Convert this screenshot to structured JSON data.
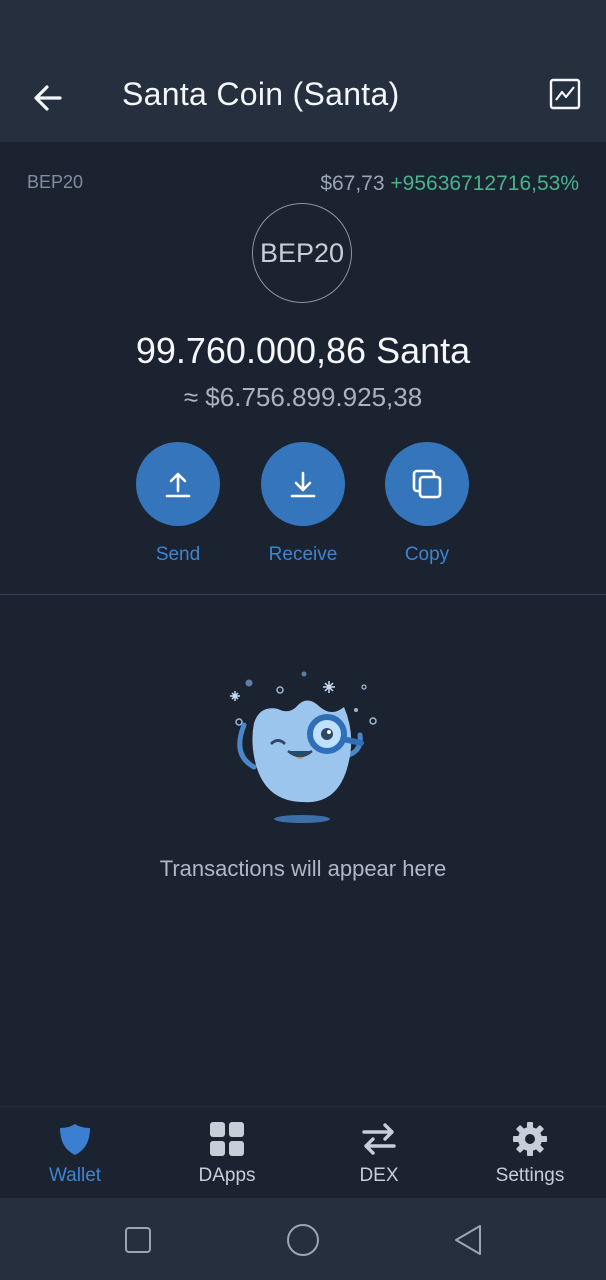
{
  "status_bar": {
    "time": "",
    "indicators": ""
  },
  "header": {
    "title": "Santa Coin (Santa)"
  },
  "token": {
    "network": "BEP20",
    "logo_text": "BEP20",
    "price": "$67,73",
    "change": "+95636712716,53%",
    "balance": "99.760.000,86 Santa",
    "fiat_value": "≈ $6.756.899.925,38"
  },
  "actions": [
    {
      "label": "Send",
      "icon": "upload-icon"
    },
    {
      "label": "Receive",
      "icon": "download-icon"
    },
    {
      "label": "Copy",
      "icon": "copy-icon"
    }
  ],
  "empty_state": {
    "message": "Transactions will appear here"
  },
  "bottom_nav": [
    {
      "label": "Wallet",
      "icon": "shield-icon",
      "active": true
    },
    {
      "label": "DApps",
      "icon": "grid-icon",
      "active": false
    },
    {
      "label": "DEX",
      "icon": "swap-arrows-icon",
      "active": false
    },
    {
      "label": "Settings",
      "icon": "gear-icon",
      "active": false
    }
  ],
  "colors": {
    "background": "#1b2230",
    "header": "#252f3d",
    "accent": "#3475bb",
    "positive": "#49b38a"
  }
}
